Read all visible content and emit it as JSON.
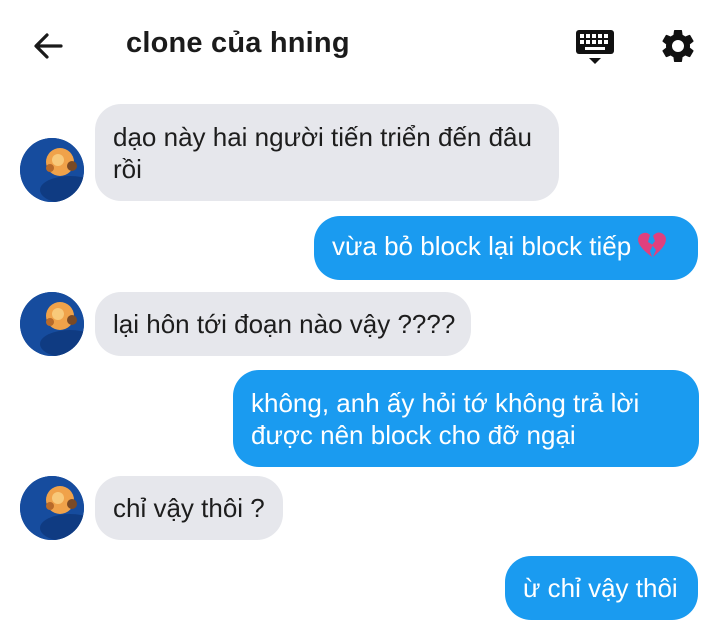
{
  "header": {
    "title": "clone của hning",
    "back_icon": "arrow-left-icon",
    "keyboard_icon": "keyboard-icon",
    "settings_icon": "gear-icon"
  },
  "messages": [
    {
      "direction": "incoming",
      "lines": [
        "dạo này hai người tiến triển đến đâu",
        "rồi"
      ]
    },
    {
      "direction": "outgoing",
      "lines": [
        "vừa bỏ block lại block tiếp"
      ],
      "emoji": "broken-heart-icon"
    },
    {
      "direction": "incoming",
      "lines": [
        "lại hôn tới đoạn nào vậy ????"
      ]
    },
    {
      "direction": "outgoing",
      "lines": [
        "không, anh ấy hỏi tớ không trả lời",
        "được nên block cho đỡ ngại"
      ]
    },
    {
      "direction": "incoming",
      "lines": [
        "chỉ vậy thôi ?"
      ]
    },
    {
      "direction": "outgoing",
      "lines": [
        "ừ chỉ vậy thôi"
      ]
    }
  ],
  "colors": {
    "incoming_bubble": "#e6e7ec",
    "outgoing_bubble": "#1a9bf0",
    "avatar_bg": "#164c9e",
    "heart": "#e0407e"
  }
}
